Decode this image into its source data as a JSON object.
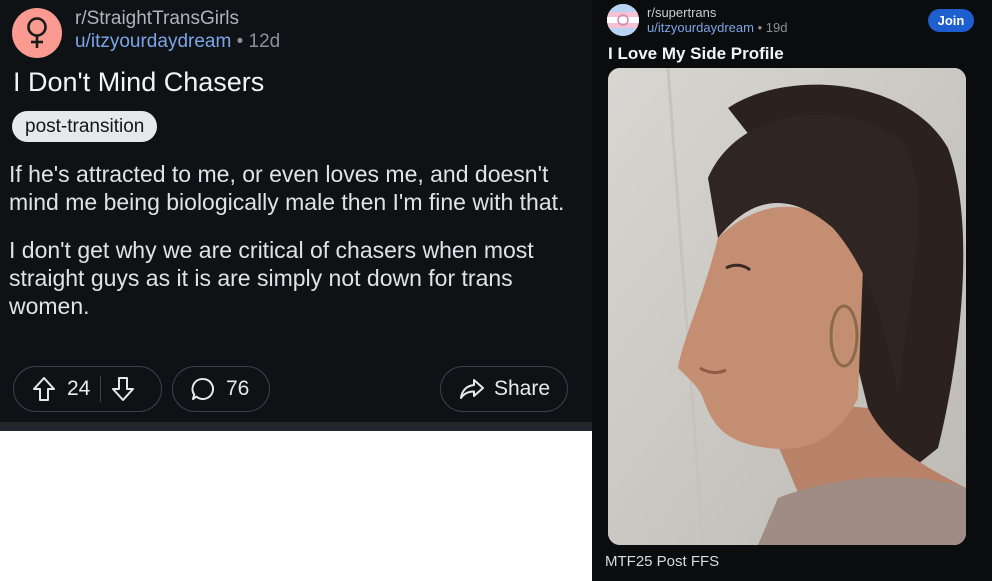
{
  "left_post": {
    "subreddit": "r/StraightTransGirls",
    "username": "u/itzyourdaydream",
    "separator": "•",
    "age": "12d",
    "title": "I Don't Mind Chasers",
    "flair": "post-transition",
    "body": [
      "If he's attracted to me, or even loves me, and doesn't mind me being biologically male then I'm fine with that.",
      "I don't get why we are critical of chasers when most straight guys as it is are simply not down for trans women."
    ],
    "upvotes": "24",
    "comments": "76",
    "share_label": "Share",
    "avatar_icon": "female-symbol-icon",
    "avatar_color": "#fa9a90"
  },
  "right_post": {
    "subreddit": "r/supertrans",
    "username": "u/itzyourdaydream",
    "separator": "•",
    "age": "19d",
    "join_label": "Join",
    "title": "I Love My Side Profile",
    "caption": "MTF25 Post FFS",
    "join_color": "#1d5fce"
  }
}
